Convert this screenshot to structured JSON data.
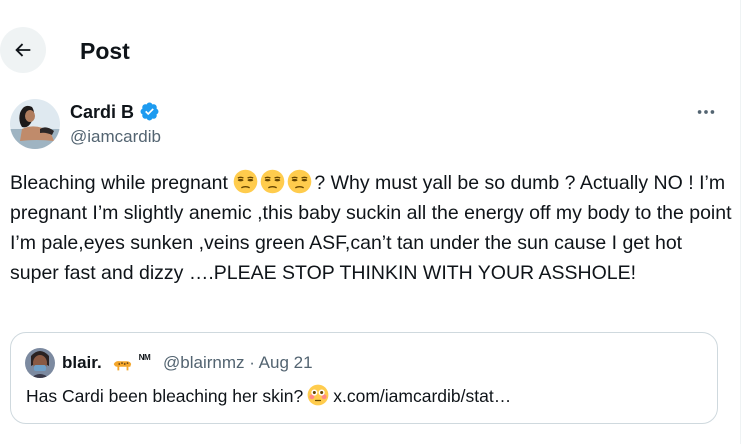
{
  "header": {
    "title": "Post"
  },
  "post": {
    "author_name": "Cardi B",
    "handle": "@iamcardib",
    "text_before_emoji": "Bleaching while pregnant",
    "emoji": "😒😒😒",
    "text_after_emoji": "? Why must yall be so dumb ? Actually NO ! I’m pregnant I’m slightly anemic ,this baby suckin all the energy off my body to the point I’m pale,eyes sunken ,veins green ASF,can’t tan under the sun cause I get hot super fast and dizzy ….PLEAE STOP THINKIN WITH YOUR ASSHOLE!"
  },
  "quote": {
    "author_name": "blair.",
    "name_badge": "ᴺᴹ",
    "handle_and_date": "@blairnmz · Aug 21",
    "text_before": "Has Cardi been bleaching her skin?",
    "emoji": "😳",
    "link": "x.com/iamcardib/stat…"
  },
  "colors": {
    "verified_blue": "#1d9bf0",
    "secondary_text": "#536471",
    "border": "#cfd9de"
  },
  "icons": {
    "back": "arrow-left-icon",
    "more": "more-horizontal-icon",
    "verified": "verified-badge-icon"
  }
}
